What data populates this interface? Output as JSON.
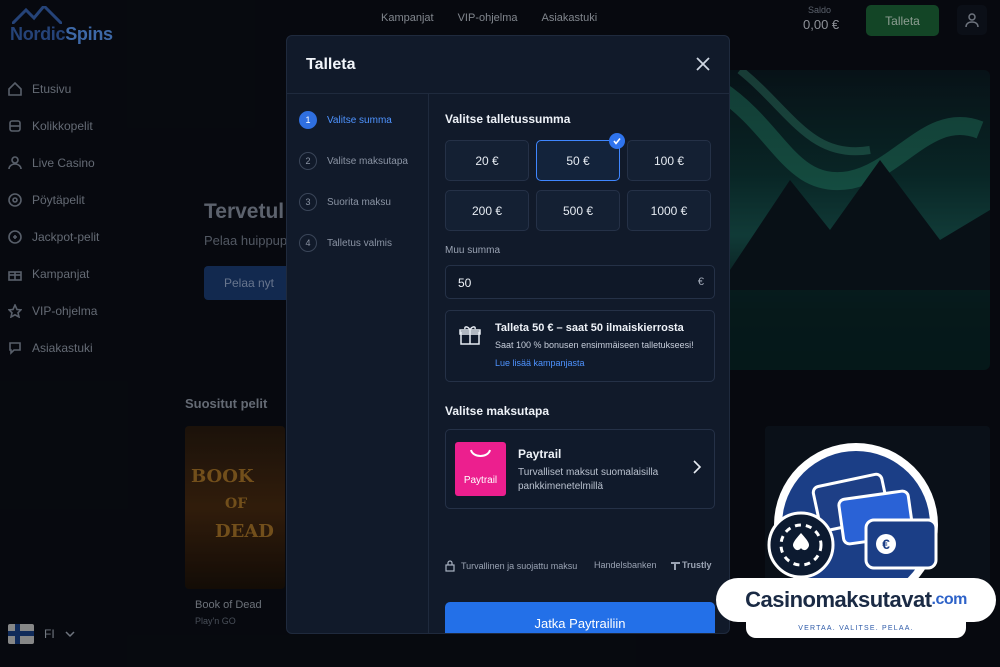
{
  "brand": {
    "name_part1": "Nordic",
    "name_part2": "Spins"
  },
  "topnav": [
    "Kampanjat",
    "VIP-ohjelma",
    "Asiakastuki"
  ],
  "balance": {
    "label": "Saldo",
    "value": "0,00 €"
  },
  "top_deposit_label": "Talleta",
  "sidebar": [
    {
      "label": "Etusivu",
      "icon": "home-icon"
    },
    {
      "label": "Kolikkopelit",
      "icon": "slot-machine-icon"
    },
    {
      "label": "Live Casino",
      "icon": "person-icon"
    },
    {
      "label": "Pöytäpelit",
      "icon": "chip-icon"
    },
    {
      "label": "Jackpot-pelit",
      "icon": "jackpot-icon"
    },
    {
      "label": "Kampanjat",
      "icon": "gift-icon"
    },
    {
      "label": "VIP-ohjelma",
      "icon": "star-icon"
    },
    {
      "label": "Asiakastuki",
      "icon": "chat-icon"
    }
  ],
  "language": "FI",
  "hero": {
    "title": "Tervetul",
    "subtitle": "Pelaa huippup",
    "button": "Pelaa nyt"
  },
  "popular": {
    "heading": "Suositut pelit",
    "game_name": "Book of Dead",
    "game_provider": "Play'n GO",
    "thumb_lines": [
      "BOOK",
      "OF",
      "DEAD"
    ]
  },
  "modal": {
    "title": "Talleta",
    "steps": [
      {
        "num": "1",
        "label": "Valitse summa",
        "active": true
      },
      {
        "num": "2",
        "label": "Valitse maksutapa",
        "active": false
      },
      {
        "num": "3",
        "label": "Suorita maksu",
        "active": false
      },
      {
        "num": "4",
        "label": "Talletus valmis",
        "active": false
      }
    ],
    "amount_heading": "Valitse talletussumma",
    "amounts": [
      "20 €",
      "50 €",
      "100 €",
      "200 €",
      "500 €",
      "1000 €"
    ],
    "selected_amount": "50 €",
    "custom_label": "Muu summa",
    "custom_value": "50",
    "custom_currency": "€",
    "bonus": {
      "title": "Talleta 50 € – saat 50 ilmaiskierrosta",
      "subtitle": "Saat 100 % bonusen ensimmäiseen talletukseesi!",
      "link": "Lue lisää kampanjasta"
    },
    "payment_heading": "Valitse maksutapa",
    "payment": {
      "logo_text": "Paytrail",
      "name": "Paytrail",
      "description": "Turvalliset maksut suomalaisilla pankkimenetelmillä"
    },
    "trust": {
      "secure": "Turvallinen ja suojattu maksu",
      "bank": "Handelsbanken",
      "provider": "Trustly"
    },
    "cta": "Jatka Paytrailiin"
  },
  "watermark": {
    "name": "Casinomaksutavat",
    "tld": ".com",
    "tagline": "VERTAA. VALITSE. PELAA."
  }
}
